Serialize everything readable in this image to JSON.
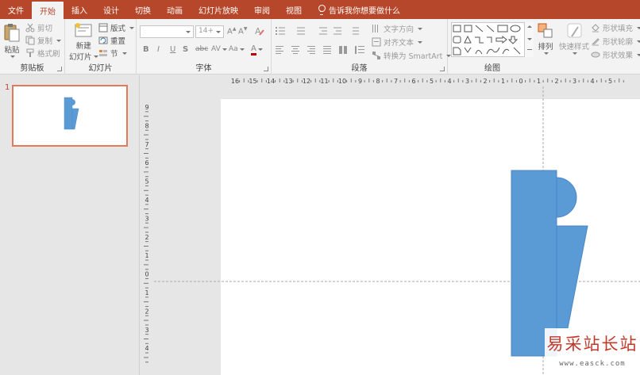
{
  "tabs": [
    {
      "label": "文件",
      "active": false
    },
    {
      "label": "开始",
      "active": true
    },
    {
      "label": "插入",
      "active": false
    },
    {
      "label": "设计",
      "active": false
    },
    {
      "label": "切换",
      "active": false
    },
    {
      "label": "动画",
      "active": false
    },
    {
      "label": "幻灯片放映",
      "active": false
    },
    {
      "label": "审阅",
      "active": false
    },
    {
      "label": "视图",
      "active": false
    }
  ],
  "tell_me": "告诉我你想要做什么",
  "clipboard": {
    "paste": "粘贴",
    "cut": "剪切",
    "copy": "复制",
    "format_painter": "格式刷",
    "label": "剪贴板"
  },
  "slides": {
    "new_slide_line1": "新建",
    "new_slide_line2": "幻灯片",
    "layout": "版式",
    "reset": "重置",
    "section": "节",
    "label": "幻灯片"
  },
  "font": {
    "size": "14+",
    "bold": "B",
    "italic": "I",
    "underline": "U",
    "shadow": "S",
    "strike": "abc",
    "spacing": "AV",
    "case": "Aa",
    "color": "A",
    "label": "字体"
  },
  "paragraph": {
    "text_direction": "文字方向",
    "align_text": "对齐文本",
    "smartart": "转换为 SmartArt",
    "label": "段落"
  },
  "drawing": {
    "arrange": "排列",
    "quick_styles": "快速样式",
    "fill": "形状填充",
    "outline": "形状轮廓",
    "effects": "形状效果",
    "label": "绘图"
  },
  "hruler": [
    "16",
    "15",
    "14",
    "13",
    "12",
    "11",
    "10",
    "9",
    "8",
    "7",
    "6",
    "5",
    "4",
    "3",
    "2",
    "1",
    "0",
    "1",
    "2",
    "3",
    "4",
    "5"
  ],
  "vruler": [
    "9",
    "8",
    "7",
    "6",
    "5",
    "4",
    "3",
    "2",
    "1",
    "0",
    "1",
    "2",
    "3",
    "4"
  ],
  "slide_number": "1",
  "colors": {
    "accent": "#b7472a",
    "shape_fill": "#5b9bd5",
    "shape_stroke": "#4a86c5"
  },
  "watermark": {
    "title": "易采站长站",
    "url": "www.easck.com"
  }
}
